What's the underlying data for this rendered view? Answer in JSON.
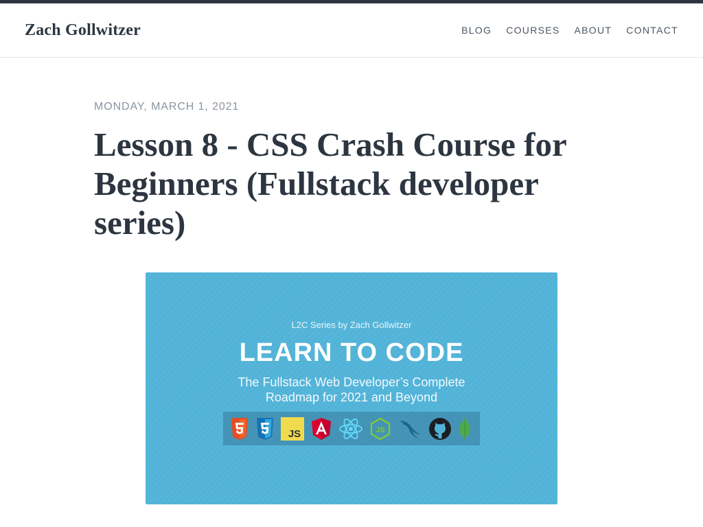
{
  "site": {
    "title": "Zach Gollwitzer"
  },
  "nav": {
    "items": [
      {
        "label": "BLOG"
      },
      {
        "label": "COURSES"
      },
      {
        "label": "ABOUT"
      },
      {
        "label": "CONTACT"
      }
    ]
  },
  "post": {
    "date": "MONDAY, MARCH 1, 2021",
    "title": "Lesson 8 - CSS Crash Course for Beginners (Fullstack developer series)"
  },
  "hero": {
    "byline": "L2C Series by Zach Gollwitzer",
    "heading": "LEARN TO CODE",
    "subtitle_line1": "The Fullstack Web Developer’s Complete",
    "subtitle_line2": "Roadmap for 2021 and Beyond",
    "background_color": "#52b3d8",
    "tech_icons": [
      "html5-icon",
      "css3-icon",
      "javascript-icon",
      "angular-icon",
      "react-icon",
      "nodejs-icon",
      "mysql-icon",
      "github-icon",
      "mongodb-icon"
    ],
    "js_label": "JS"
  },
  "colors": {
    "text": "#2d3640",
    "muted": "#8a94a0",
    "accent_bar": "#2d3640"
  }
}
